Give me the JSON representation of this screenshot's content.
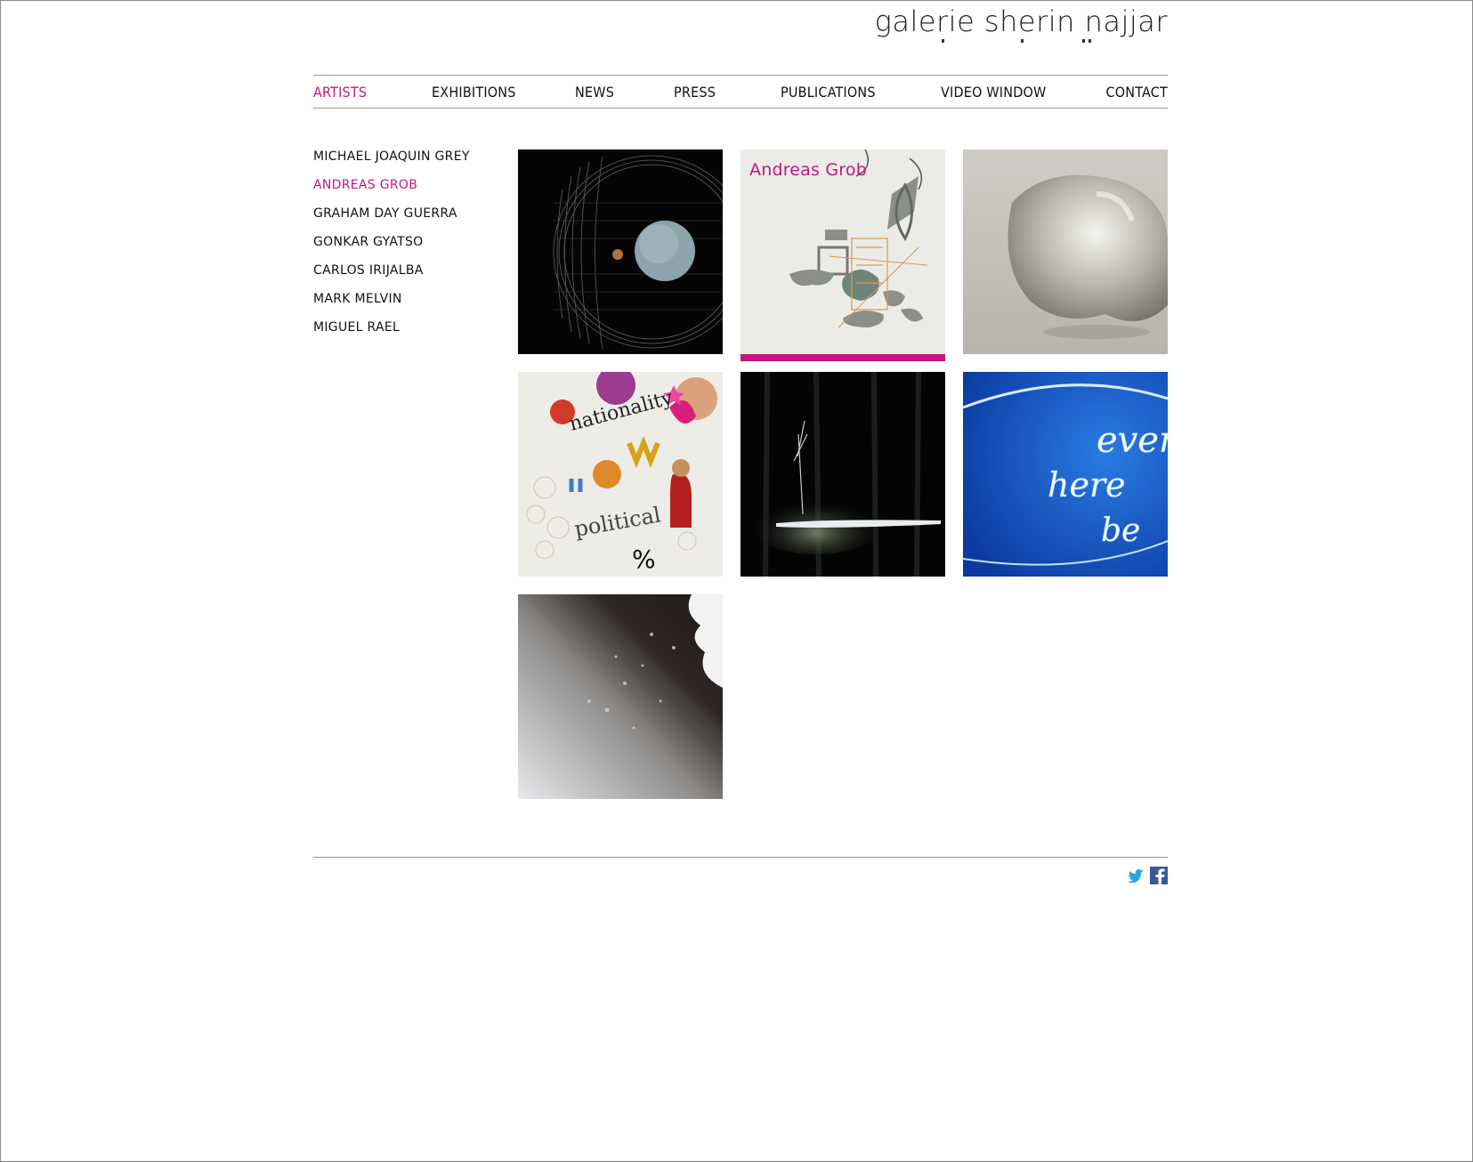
{
  "site": {
    "logo_text": "galerie sherin najjar"
  },
  "nav": {
    "items": [
      {
        "label": "ARTISTS",
        "active": true
      },
      {
        "label": "EXHIBITIONS"
      },
      {
        "label": "NEWS"
      },
      {
        "label": "PRESS"
      },
      {
        "label": "PUBLICATIONS"
      },
      {
        "label": "VIDEO WINDOW"
      },
      {
        "label": "CONTACT"
      }
    ]
  },
  "artists": [
    {
      "name": "MICHAEL JOAQUIN GREY"
    },
    {
      "name": "ANDREAS GROB",
      "active": true
    },
    {
      "name": "GRAHAM DAY GUERRA"
    },
    {
      "name": "GONKAR GYATSO"
    },
    {
      "name": "CARLOS IRIJALBA"
    },
    {
      "name": "MARK MELVIN"
    },
    {
      "name": "MIGUEL RAEL"
    }
  ],
  "thumbnails": {
    "hover_label": "Andreas Grob",
    "nationality_text": "nationality",
    "political_text": "political",
    "percent_text": "%",
    "neon_words": [
      "ever",
      "here",
      "be"
    ]
  },
  "colors": {
    "accent": "#c2187b",
    "text": "#111111",
    "rule": "#9a9a9a"
  },
  "footer": {
    "icons": [
      "twitter-icon",
      "facebook-icon"
    ]
  }
}
